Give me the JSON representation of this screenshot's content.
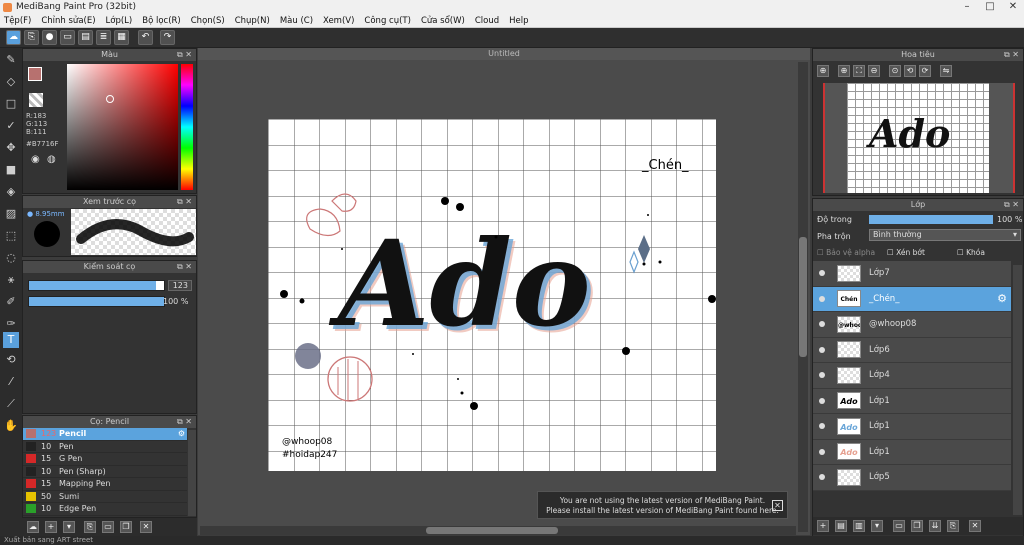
{
  "window": {
    "title": "MediBang Paint Pro (32bit)",
    "min": "–",
    "max": "□",
    "close": "✕"
  },
  "menu": [
    "Tệp(F)",
    "Chỉnh sửa(E)",
    "Lớp(L)",
    "Bộ lọc(R)",
    "Chọn(S)",
    "Chụp(N)",
    "Màu (C)",
    "Xem(V)",
    "Công cụ(T)",
    "Cửa sổ(W)",
    "Cloud",
    "Help"
  ],
  "color_panel": {
    "title": "Màu",
    "r": "R:183",
    "g": "G:113",
    "b": "B:111",
    "hex": "#B7716F",
    "fg": "#b7716f"
  },
  "brush_preview": {
    "title": "Xem trước cọ",
    "size": "8.95mm"
  },
  "brush_control": {
    "title": "Kiểm soát cọ",
    "size_value": "123",
    "opacity_value": "100 %"
  },
  "brush_list": {
    "title": "Cọ: Pencil",
    "items": [
      {
        "size": "123",
        "name": "Pencil",
        "color": "#b7716f",
        "selected": true
      },
      {
        "size": "10",
        "name": "Pen",
        "color": "#222222"
      },
      {
        "size": "15",
        "name": "G Pen",
        "color": "#d62828"
      },
      {
        "size": "10",
        "name": "Pen (Sharp)",
        "color": "#222222"
      },
      {
        "size": "15",
        "name": "Mapping Pen",
        "color": "#d62828"
      },
      {
        "size": "50",
        "name": "Sumi",
        "color": "#e6c200"
      },
      {
        "size": "10",
        "name": "Edge Pen",
        "color": "#2aa02a"
      }
    ]
  },
  "canvas": {
    "tab": "Untitled",
    "text_top": "_Chén_",
    "text_main": "Ado",
    "credit1": "@whoop08",
    "credit2": "#hoidap247"
  },
  "notice": {
    "line1": "You are not using the latest version of MediBang Paint.",
    "line2": "Please install the latest version of MediBang Paint found here."
  },
  "navigator": {
    "title": "Hoa tiêu"
  },
  "layer_panel": {
    "title": "Lớp",
    "opacity_label": "Độ trong",
    "opacity_value": "100 %",
    "blend_label": "Pha trộn",
    "blend_value": "Bình thường",
    "protect_alpha": "Bảo vệ alpha",
    "clipping": "Xén bớt",
    "lock": "Khóa",
    "layers": [
      {
        "name": "Lớp7",
        "thumb": ""
      },
      {
        "name": "_Chén_",
        "thumb": "Chén",
        "selected": true
      },
      {
        "name": "@whoop08",
        "thumb": "@whoop"
      },
      {
        "name": "Lớp6",
        "thumb": ""
      },
      {
        "name": "Lớp4",
        "thumb": ""
      },
      {
        "name": "Lớp1",
        "thumb": "Ado"
      },
      {
        "name": "Lớp1",
        "thumb": "Ado"
      },
      {
        "name": "Lớp1",
        "thumb": "Ado"
      },
      {
        "name": "Lớp5",
        "thumb": ""
      }
    ]
  },
  "statusbar": {
    "text": "Xuất bản sang ART street"
  }
}
